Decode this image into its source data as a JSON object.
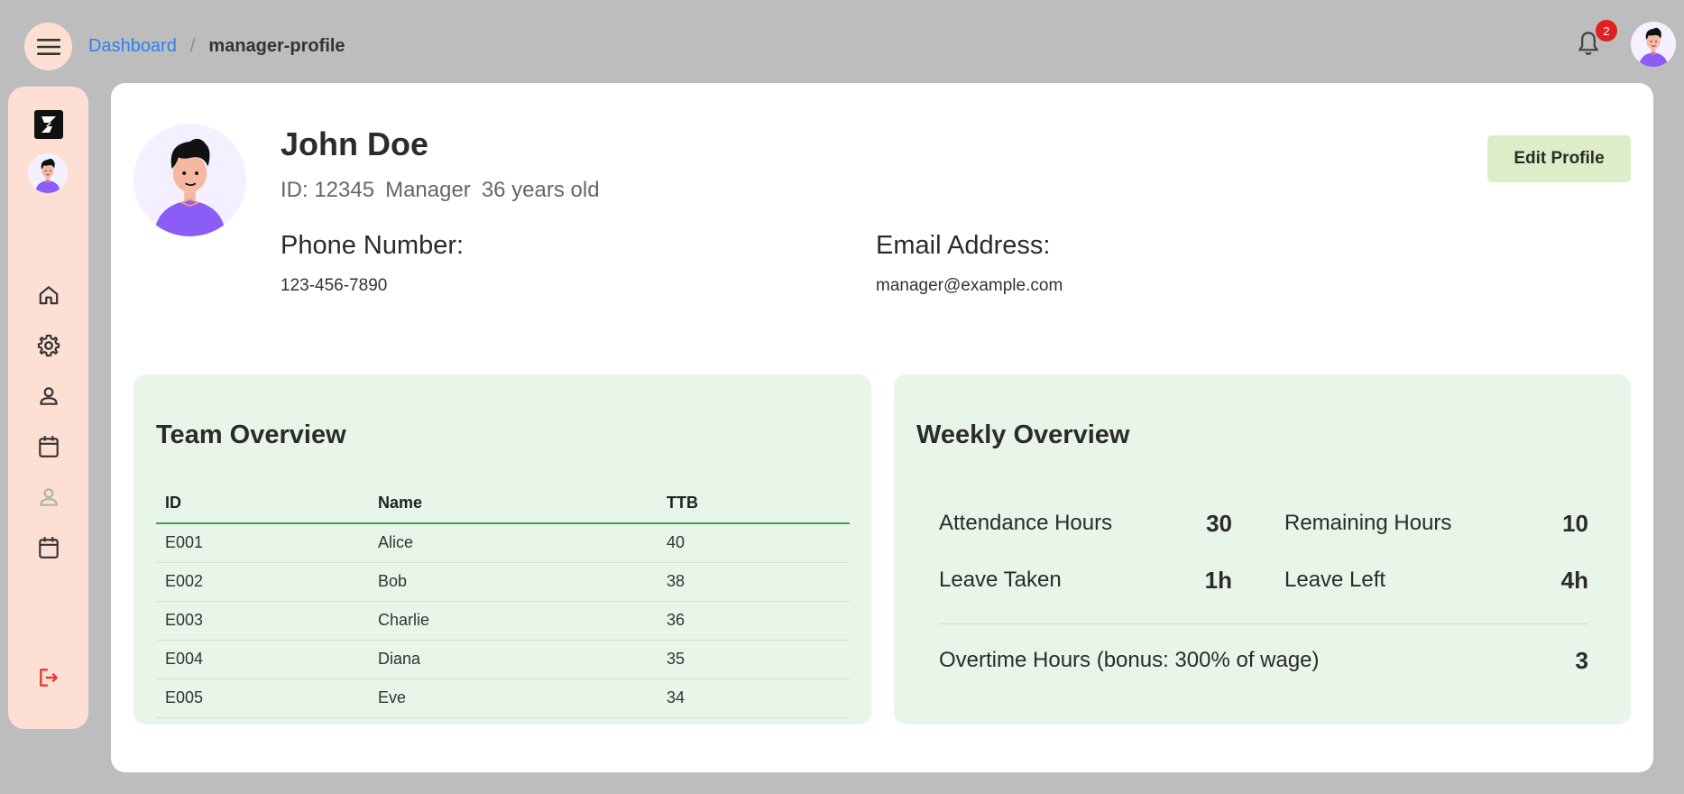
{
  "breadcrumb": {
    "parent": "Dashboard",
    "separator": "/",
    "current": "manager-profile"
  },
  "notifications": {
    "count": "2"
  },
  "icons": {
    "menu": "menu-icon",
    "bell": "bell-icon",
    "logo": "z-logo-icon",
    "home": "home-icon",
    "settings": "gear-icon",
    "user": "user-icon",
    "calendar": "calendar-icon",
    "logout": "logout-icon"
  },
  "colors": {
    "sidebar": "#fde0d3",
    "link": "#2f80ed",
    "panel": "#e8f5e9",
    "edit_button": "#dcedc8",
    "badge": "#e02020",
    "logout": "#e53935"
  },
  "profile": {
    "name": "John Doe",
    "id": "ID: 12345",
    "role": "Manager",
    "age": "36 years old",
    "phone_label": "Phone Number:",
    "phone": "123-456-7890",
    "email_label": "Email Address:",
    "email": "manager@example.com",
    "edit_label": "Edit Profile"
  },
  "team": {
    "title": "Team Overview",
    "columns": [
      "ID",
      "Name",
      "TTB"
    ],
    "rows": [
      [
        "E001",
        "Alice",
        "40"
      ],
      [
        "E002",
        "Bob",
        "38"
      ],
      [
        "E003",
        "Charlie",
        "36"
      ],
      [
        "E004",
        "Diana",
        "35"
      ],
      [
        "E005",
        "Eve",
        "34"
      ]
    ]
  },
  "weekly": {
    "title": "Weekly Overview",
    "attendance_label": "Attendance Hours",
    "attendance_value": "30",
    "remaining_label": "Remaining Hours",
    "remaining_value": "10",
    "leave_taken_label": "Leave Taken",
    "leave_taken_value": "1h",
    "leave_left_label": "Leave Left",
    "leave_left_value": "4h",
    "overtime_label": "Overtime Hours (bonus: 300% of wage)",
    "overtime_value": "3"
  }
}
